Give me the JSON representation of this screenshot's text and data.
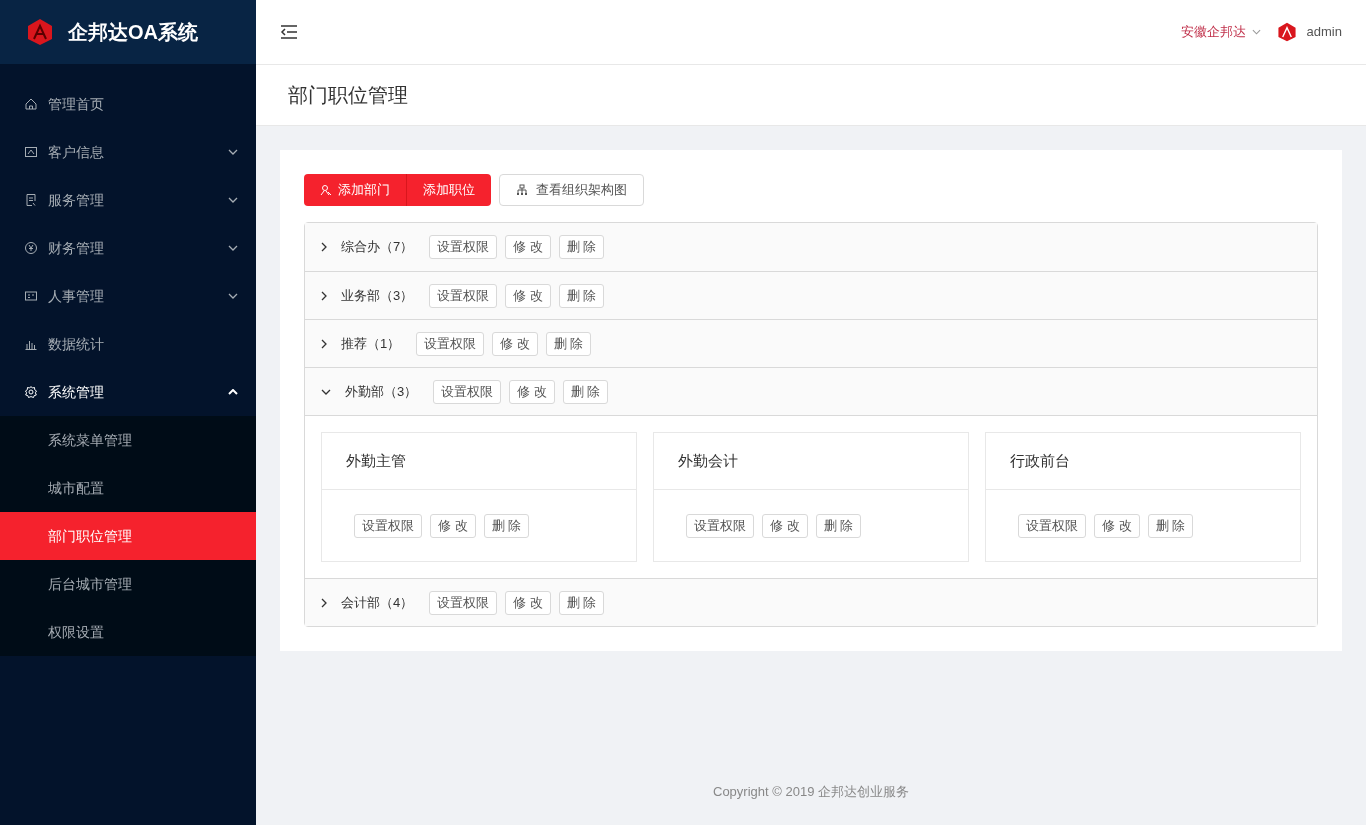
{
  "app": {
    "title": "企邦达OA系统"
  },
  "sidebar": {
    "items": [
      {
        "label": "管理首页",
        "kind": "link",
        "expanded": false
      },
      {
        "label": "客户信息",
        "kind": "group",
        "expanded": false
      },
      {
        "label": "服务管理",
        "kind": "group",
        "expanded": false
      },
      {
        "label": "财务管理",
        "kind": "group",
        "expanded": false
      },
      {
        "label": "人事管理",
        "kind": "group",
        "expanded": false
      },
      {
        "label": "数据统计",
        "kind": "link",
        "expanded": false
      },
      {
        "label": "系统管理",
        "kind": "group",
        "expanded": true,
        "children": [
          {
            "label": "系统菜单管理",
            "selected": false
          },
          {
            "label": "城市配置",
            "selected": false
          },
          {
            "label": "部门职位管理",
            "selected": true
          },
          {
            "label": "后台城市管理",
            "selected": false
          },
          {
            "label": "权限设置",
            "selected": false
          }
        ]
      }
    ]
  },
  "header": {
    "company": "安徽企邦达",
    "user": "admin"
  },
  "page_title": "部门职位管理",
  "toolbar": {
    "add_department": "添加部门",
    "add_position": "添加职位",
    "org_chart": "查看组织架构图"
  },
  "departments": [
    {
      "name": "综合办（7）",
      "expanded": false,
      "actions": [
        "设置权限",
        "修 改",
        "删 除"
      ]
    },
    {
      "name": "业务部（3）",
      "expanded": false,
      "actions": [
        "设置权限",
        "修 改",
        "删 除"
      ]
    },
    {
      "name": "推荐（1）",
      "expanded": false,
      "actions": [
        "设置权限",
        "修 改",
        "删 除"
      ]
    },
    {
      "name": "外勤部（3）",
      "expanded": true,
      "actions": [
        "设置权限",
        "修 改",
        "删 除"
      ],
      "positions": [
        {
          "name": "外勤主管",
          "actions": [
            "设置权限",
            "修 改",
            "删 除"
          ]
        },
        {
          "name": "外勤会计",
          "actions": [
            "设置权限",
            "修 改",
            "删 除"
          ]
        },
        {
          "name": "行政前台",
          "actions": [
            "设置权限",
            "修 改",
            "删 除"
          ]
        }
      ]
    },
    {
      "name": "会计部（4）",
      "expanded": false,
      "actions": [
        "设置权限",
        "修 改",
        "删 除"
      ]
    }
  ],
  "footer": "Copyright © 2019 企邦达创业服务"
}
